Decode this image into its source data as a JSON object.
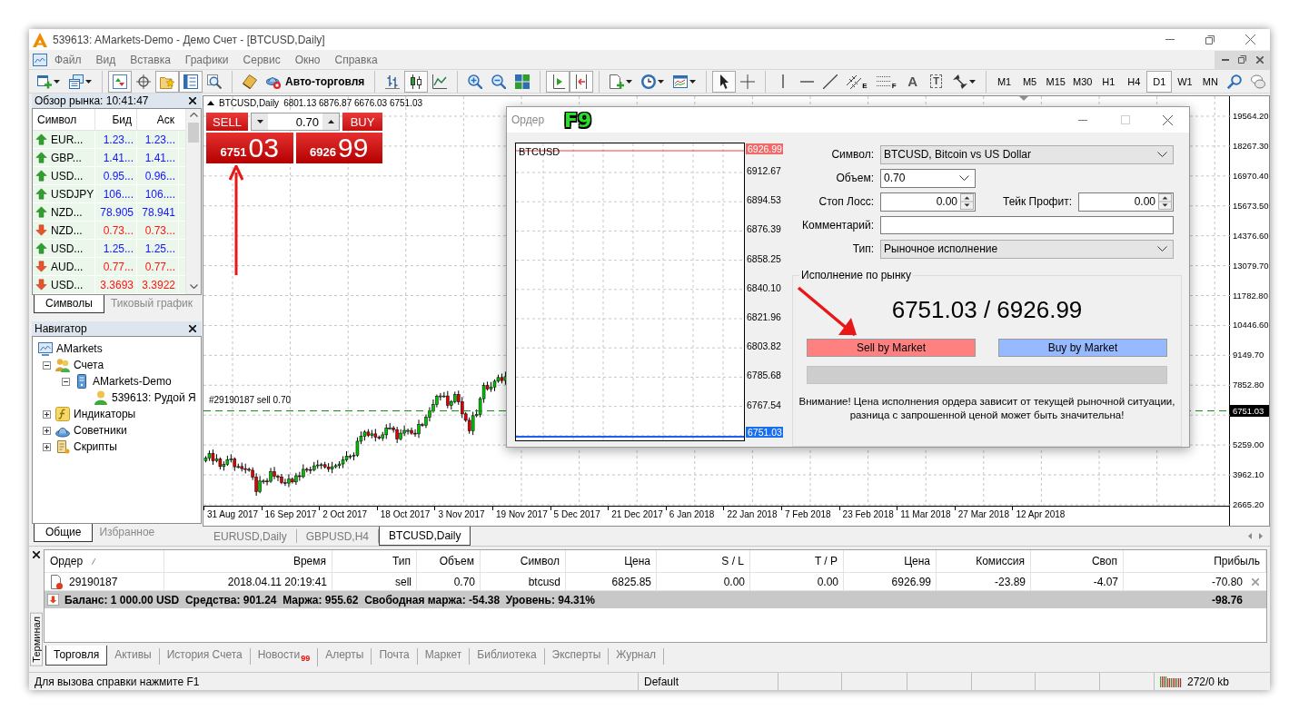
{
  "window": {
    "title": "539613: AMarkets-Demo - Демо Счет - [BTCUSD,Daily]"
  },
  "menu": [
    "Файл",
    "Вид",
    "Вставка",
    "Графики",
    "Сервис",
    "Окно",
    "Справка"
  ],
  "toolbar": {
    "groups": [
      {
        "items": [
          {
            "kind": "newchart",
            "pressed": false
          },
          {
            "kind": "profiles",
            "pressed": false
          }
        ]
      },
      {
        "items": [
          {
            "kind": "marketwatch",
            "pressed": true
          },
          {
            "kind": "datawindow",
            "pressed": false
          },
          {
            "kind": "navigator",
            "pressed": true
          },
          {
            "kind": "terminal",
            "pressed": true
          },
          {
            "kind": "tester",
            "pressed": false
          }
        ]
      },
      {
        "items": [
          {
            "kind": "editor",
            "pressed": false
          },
          {
            "kind": "autotrading",
            "label": "Авто-торговля",
            "pressed": false
          }
        ]
      },
      {
        "items": [
          {
            "kind": "barchart",
            "pressed": false
          },
          {
            "kind": "candles",
            "pressed": true
          },
          {
            "kind": "linechart",
            "pressed": false
          }
        ]
      },
      {
        "items": [
          {
            "kind": "zoomin",
            "pressed": false
          },
          {
            "kind": "zoomout",
            "pressed": false
          },
          {
            "kind": "tile",
            "pressed": false
          }
        ]
      },
      {
        "items": [
          {
            "kind": "autoscroll",
            "pressed": true
          },
          {
            "kind": "shift",
            "pressed": true
          }
        ]
      },
      {
        "items": [
          {
            "kind": "indicators",
            "pressed": false
          },
          {
            "kind": "periods",
            "pressed": false
          },
          {
            "kind": "templates",
            "pressed": false
          }
        ]
      },
      {
        "items": [
          {
            "kind": "cursor",
            "pressed": true
          },
          {
            "kind": "crosshair",
            "pressed": false
          }
        ]
      },
      {
        "items": [
          {
            "kind": "vline",
            "pressed": false
          },
          {
            "kind": "hline",
            "pressed": false
          },
          {
            "kind": "trendline",
            "pressed": false
          },
          {
            "kind": "channel",
            "glyph": "E",
            "pressed": false
          },
          {
            "kind": "fibo",
            "glyph": "F",
            "pressed": false
          },
          {
            "kind": "text",
            "glyph": "A",
            "pressed": false
          },
          {
            "kind": "label",
            "glyph": "T",
            "pressed": false
          },
          {
            "kind": "arrows",
            "pressed": false
          }
        ]
      },
      {
        "items": [
          {
            "kind": "period",
            "label": "M1",
            "selected": false
          },
          {
            "kind": "period",
            "label": "M5",
            "selected": false
          },
          {
            "kind": "period",
            "label": "M15",
            "selected": false
          },
          {
            "kind": "period",
            "label": "M30",
            "selected": false
          },
          {
            "kind": "period",
            "label": "H1",
            "selected": false
          },
          {
            "kind": "period",
            "label": "H4",
            "selected": false
          },
          {
            "kind": "period",
            "label": "D1",
            "selected": true
          },
          {
            "kind": "period",
            "label": "W1",
            "selected": false
          },
          {
            "kind": "period",
            "label": "MN",
            "selected": false
          },
          {
            "kind": "search",
            "pressed": false
          },
          {
            "kind": "chat",
            "pressed": false
          }
        ]
      }
    ]
  },
  "market_watch": {
    "title": "Обзор рынка: 10:41:47",
    "columns": [
      "Символ",
      "Бид",
      "Аск"
    ],
    "rows": [
      {
        "symbol": "EUR...",
        "bid": "1.23...",
        "ask": "1.23...",
        "rising": true
      },
      {
        "symbol": "GBP...",
        "bid": "1.41...",
        "ask": "1.41...",
        "rising": true
      },
      {
        "symbol": "USD...",
        "bid": "0.95...",
        "ask": "0.96...",
        "rising": true
      },
      {
        "symbol": "USDJPY",
        "bid": "106....",
        "ask": "106....",
        "rising": true
      },
      {
        "symbol": "NZD...",
        "bid": "78.905",
        "ask": "78.941",
        "rising": true
      },
      {
        "symbol": "NZD...",
        "bid": "0.73...",
        "ask": "0.73...",
        "rising": false
      },
      {
        "symbol": "USD...",
        "bid": "1.25...",
        "ask": "1.25...",
        "rising": true
      },
      {
        "symbol": "AUD...",
        "bid": "0.77...",
        "ask": "0.77...",
        "rising": false
      },
      {
        "symbol": "USD...",
        "bid": "3.3693",
        "ask": "3.3922",
        "rising": false
      }
    ],
    "tabs": [
      {
        "label": "Символы",
        "selected": true
      },
      {
        "label": "Тиковый график",
        "selected": false
      }
    ]
  },
  "navigator": {
    "title": "Навигатор",
    "tree": [
      {
        "label": "AMarkets",
        "kind": "platform",
        "children": [
          {
            "label": "Счета",
            "kind": "accounts",
            "expanded": true,
            "children": [
              {
                "label": "AMarkets-Demo",
                "kind": "server",
                "expanded": true,
                "children": [
                  {
                    "label": "539613: Рудой Я",
                    "kind": "account"
                  }
                ]
              }
            ]
          },
          {
            "label": "Индикаторы",
            "kind": "indicators",
            "expanded": false
          },
          {
            "label": "Советники",
            "kind": "experts",
            "expanded": false
          },
          {
            "label": "Скрипты",
            "kind": "scripts",
            "expanded": false
          }
        ]
      }
    ],
    "tabs": [
      {
        "label": "Общие",
        "selected": true
      },
      {
        "label": "Избранное",
        "selected": false
      }
    ]
  },
  "chart": {
    "header": {
      "symbol": "BTCUSD,Daily",
      "ohlc": "6801.13 6876.87 6676.03 6751.03"
    },
    "one_click": {
      "sell_label": "SELL",
      "buy_label": "BUY",
      "volume": "0.70",
      "sell_price": {
        "main": "6751",
        "big": "03"
      },
      "buy_price": {
        "main": "6926",
        "big": "99"
      }
    },
    "order_line": {
      "label": "#29190187 sell 0.70"
    },
    "price_labels": [
      "19564.20",
      "18267.30",
      "16970.40",
      "15673.50",
      "14376.60",
      "13079.70",
      "11782.80",
      "10446.60",
      "9149.70",
      "7852.80",
      "5259.00",
      "3962.10",
      "2665.20"
    ],
    "current_price": "6751.03",
    "date_labels": [
      "31 Aug 2017",
      "16 Sep 2017",
      "2 Oct 2017",
      "18 Oct 2017",
      "3 Nov 2017",
      "19 Nov 2017",
      "5 Dec 2017",
      "21 Dec 2017",
      "6 Jan 2018",
      "22 Jan 2018",
      "7 Feb 2018",
      "23 Feb 2018",
      "11 Mar 2018",
      "27 Mar 2018",
      "12 Apr 2018"
    ]
  },
  "chart_tabs": [
    {
      "label": "EURUSD,Daily",
      "selected": false
    },
    {
      "label": "GBPUSD,H4",
      "selected": false
    },
    {
      "label": "BTCUSD,Daily",
      "selected": true
    }
  ],
  "order_dialog": {
    "title": "Ордер",
    "hotkey": "F9",
    "chart": {
      "symbol": "BTCUSD",
      "ask": "6926.99",
      "price_labels": [
        "6912.67",
        "6894.53",
        "6876.39",
        "6858.25",
        "6840.10",
        "6821.96",
        "6803.82",
        "6785.68",
        "6767.54"
      ],
      "bid": "6751.03"
    },
    "symbol": {
      "label": "Символ:",
      "value": "BTCUSD, Bitcoin vs US Dollar"
    },
    "volume": {
      "label": "Объем:",
      "value": "0.70"
    },
    "stop_loss": {
      "label": "Стоп Лосс:",
      "value": "0.00"
    },
    "take_profit": {
      "label": "Тейк Профит:",
      "value": "0.00"
    },
    "comment": {
      "label": "Комментарий:"
    },
    "type": {
      "label": "Тип:",
      "value": "Рыночное исполнение"
    },
    "market_execution": {
      "title": "Исполнение по рынку",
      "prices": "6751.03 / 6926.99",
      "sell_button": "Sell by Market",
      "buy_button": "Buy by Market",
      "warning": "Внимание! Цена исполнения ордера зависит от текущей рыночной ситуации,\nразница с запрошенной ценой может быть значительна!"
    }
  },
  "terminal": {
    "title": "Терминал",
    "columns": [
      {
        "label": "Ордер",
        "sorted": true
      },
      {
        "label": "Время",
        "sorted": false
      },
      {
        "label": "Тип",
        "sorted": false
      },
      {
        "label": "Объем",
        "sorted": false
      },
      {
        "label": "Символ",
        "sorted": false
      },
      {
        "label": "Цена",
        "sorted": false
      },
      {
        "label": "S / L",
        "sorted": false
      },
      {
        "label": "T / P",
        "sorted": false
      },
      {
        "label": "Цена",
        "sorted": false
      },
      {
        "label": "Комиссия",
        "sorted": false
      },
      {
        "label": "Своп",
        "sorted": false
      },
      {
        "label": "Прибыль",
        "sorted": false
      }
    ],
    "rows": [
      {
        "cells": [
          "29190187",
          "2018.04.11 20:19:41",
          "sell",
          "0.70",
          "btcusd",
          "6825.85",
          "0.00",
          "0.00",
          "6926.99",
          "-23.89",
          "-4.07",
          "-70.80"
        ]
      }
    ],
    "summary": {
      "text": "Баланс: 1 000.00 USD  Средства: 901.24  Маржа: 955.62  Свободная маржа: -54.38  Уровень: 94.31%",
      "profit": "-98.76"
    },
    "tabs": [
      {
        "label": "Торговля",
        "selected": true
      },
      {
        "label": "Активы",
        "selected": false
      },
      {
        "label": "История Счета",
        "selected": false
      },
      {
        "label": "Новости",
        "badge": "99",
        "selected": false
      },
      {
        "label": "Алерты",
        "selected": false
      },
      {
        "label": "Почта",
        "selected": false
      },
      {
        "label": "Маркет",
        "selected": false
      },
      {
        "label": "Библиотека",
        "selected": false
      },
      {
        "label": "Эксперты",
        "selected": false
      },
      {
        "label": "Журнал",
        "selected": false
      }
    ]
  },
  "status_bar": {
    "help": "Для вызова справки нажмите F1",
    "profile": "Default",
    "traffic": "272/0 kb"
  }
}
